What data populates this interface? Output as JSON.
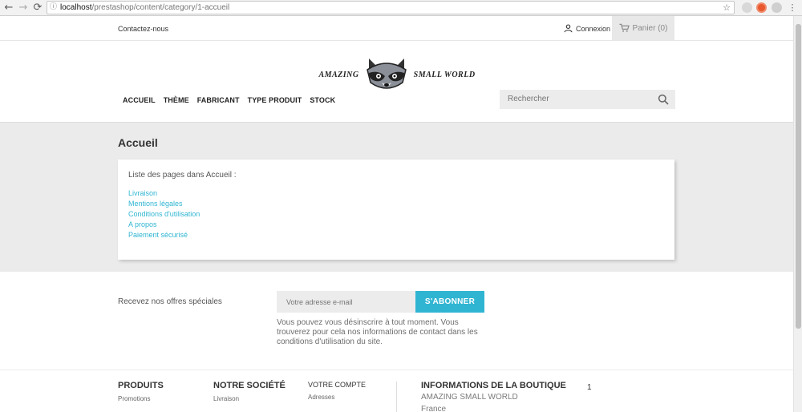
{
  "browser": {
    "url_host": "localhost",
    "url_path": "/prestashop/content/category/1-accueil"
  },
  "topnav": {
    "contact_label": "Contactez-nous",
    "login_label": "Connexion",
    "cart_label": "Panier (0)"
  },
  "header": {
    "logo_left": "AMAZING",
    "logo_right": "SMALL WORLD",
    "menu": [
      "ACCUEIL",
      "THÈME",
      "FABRICANT",
      "TYPE PRODUIT",
      "STOCK"
    ],
    "search_placeholder": "Rechercher"
  },
  "main": {
    "title": "Accueil",
    "list_heading": "Liste des pages dans Accueil :",
    "pages": [
      "Livraison",
      "Mentions légales",
      "Conditions d'utilisation",
      "A propos",
      "Paiement sécurisé"
    ]
  },
  "newsletter": {
    "label": "Recevez nos offres spéciales",
    "email_placeholder": "Votre adresse e-mail",
    "subscribe_label": "S'ABONNER",
    "note": "Vous pouvez vous désinscrire à tout moment. Vous trouverez pour cela nos informations de contact dans les conditions d'utilisation du site."
  },
  "footer": {
    "products": {
      "title": "PRODUITS",
      "first_item": "Promotions"
    },
    "company": {
      "title": "NOTRE SOCIÉTÉ",
      "first_item": "Livraison"
    },
    "account": {
      "title": "VOTRE COMPTE",
      "first_item": "Adresses"
    },
    "store": {
      "title": "INFORMATIONS DE LA BOUTIQUE",
      "name": "AMAZING SMALL WORLD",
      "country": "France"
    },
    "number": "1"
  },
  "colors": {
    "accent": "#2fb5d2",
    "main_bg": "#ebebeb"
  }
}
